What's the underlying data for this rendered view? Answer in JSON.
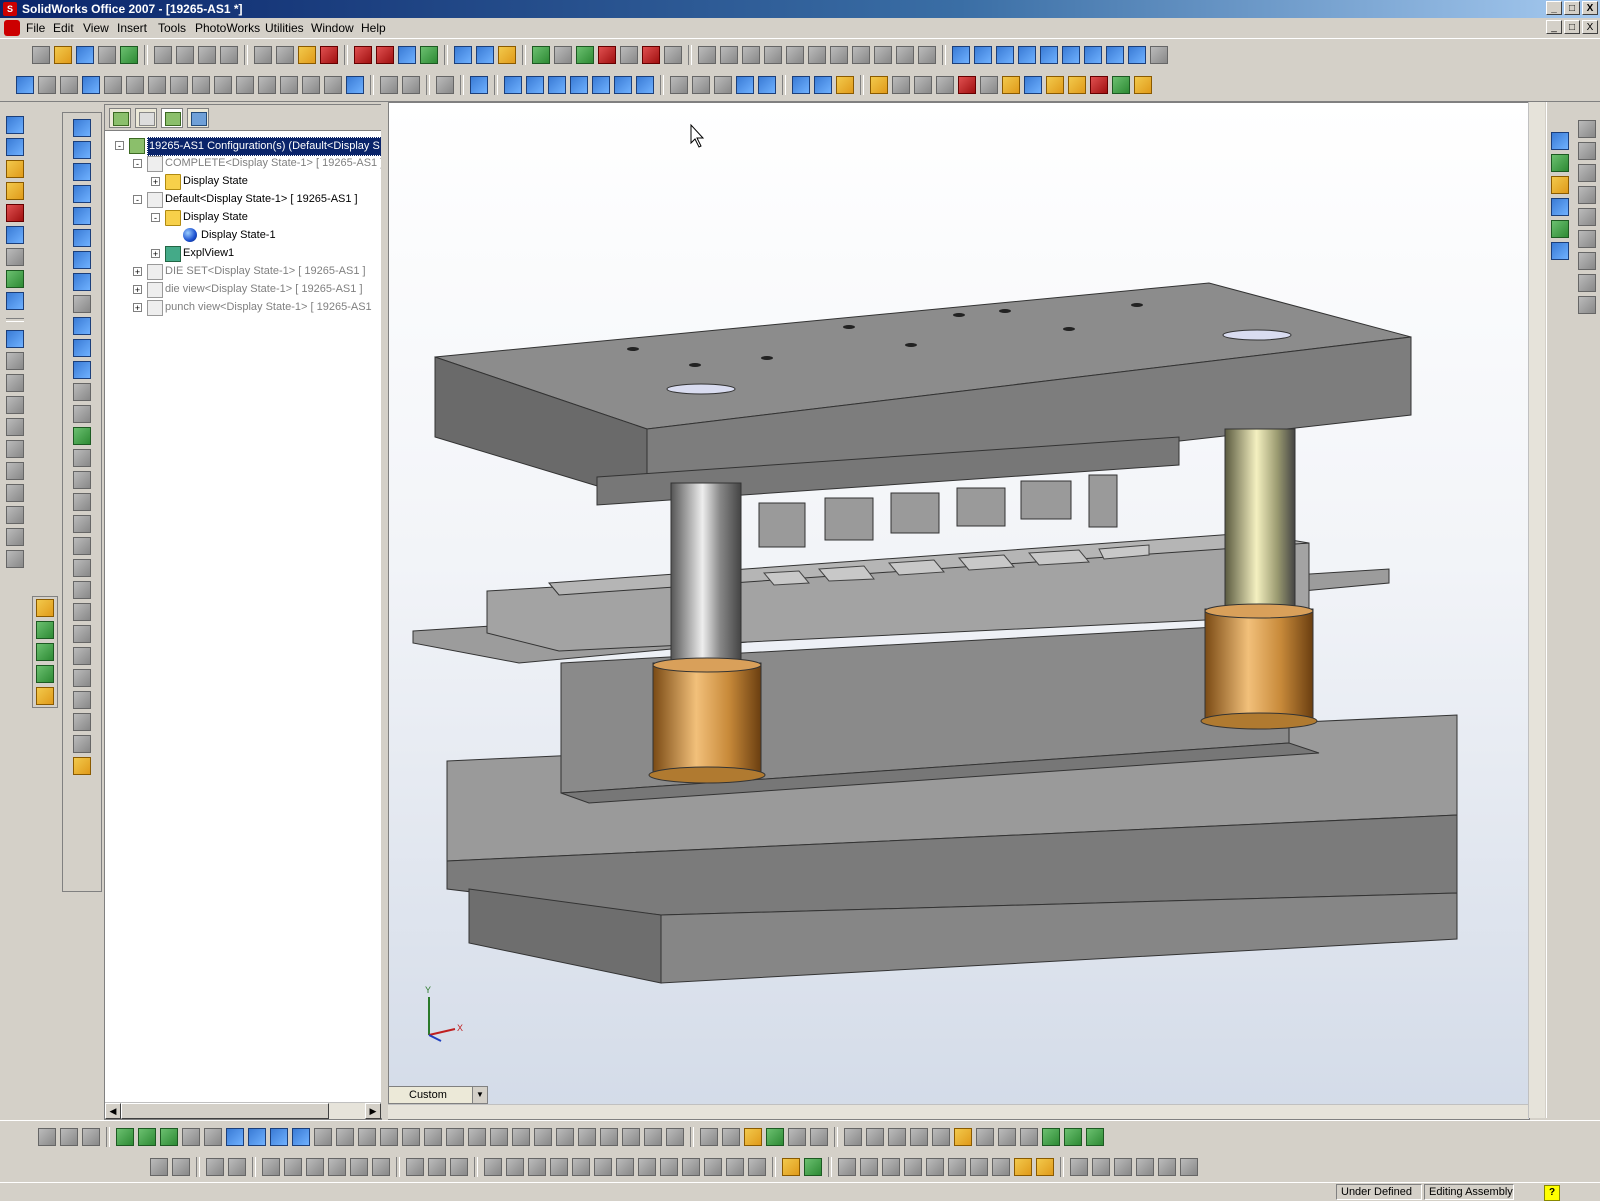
{
  "window": {
    "title": "SolidWorks Office 2007 - [19265-AS1 *]",
    "controls": [
      "_",
      "□",
      "X"
    ],
    "doc_controls": [
      "_",
      "□",
      "X"
    ]
  },
  "menu": [
    "File",
    "Edit",
    "View",
    "Insert",
    "Tools",
    "PhotoWorks",
    "Utilities",
    "Window",
    "Help"
  ],
  "feature_manager": {
    "tabs": [
      "featuremanager-tab",
      "propertymanager-tab",
      "configurationmanager-tab",
      "dimxpert-tab"
    ],
    "tree": [
      {
        "label": "19265-AS1 Configuration(s)  (Default<Display S",
        "level": 0,
        "expander": "-",
        "icon": "assembly",
        "selected": true,
        "dim": false
      },
      {
        "label": "COMPLETE<Display State-1> [ 19265-AS1 ]",
        "level": 1,
        "expander": "-",
        "icon": "config",
        "selected": false,
        "dim": true
      },
      {
        "label": "Display State",
        "level": 2,
        "expander": "+",
        "icon": "folder",
        "selected": false,
        "dim": false
      },
      {
        "label": "Default<Display State-1> [ 19265-AS1 ]",
        "level": 1,
        "expander": "-",
        "icon": "config",
        "selected": false,
        "dim": false
      },
      {
        "label": "Display State",
        "level": 2,
        "expander": "-",
        "icon": "folder",
        "selected": false,
        "dim": false
      },
      {
        "label": "Display State-1",
        "level": 3,
        "expander": "",
        "icon": "ball",
        "selected": false,
        "dim": false
      },
      {
        "label": "ExplView1",
        "level": 2,
        "expander": "+",
        "icon": "explode",
        "selected": false,
        "dim": false
      },
      {
        "label": "DIE SET<Display State-1> [ 19265-AS1 ]",
        "level": 1,
        "expander": "+",
        "icon": "config",
        "selected": false,
        "dim": true
      },
      {
        "label": "die view<Display State-1> [ 19265-AS1 ]",
        "level": 1,
        "expander": "+",
        "icon": "config",
        "selected": false,
        "dim": true
      },
      {
        "label": "punch view<Display State-1> [ 19265-AS1",
        "level": 1,
        "expander": "+",
        "icon": "config",
        "selected": false,
        "dim": true
      }
    ]
  },
  "viewport": {
    "configuration_dropdown": "Custom",
    "triad": {
      "y": "Y",
      "x": "X"
    }
  },
  "status": {
    "definition": "Under Defined",
    "mode": "Editing Assembly",
    "help": "?"
  },
  "colors": {
    "title_gradient_start": "#0a246a",
    "selection": "#0a246a",
    "plate": "#8a8a8a",
    "bushing": "#c88a3a"
  }
}
